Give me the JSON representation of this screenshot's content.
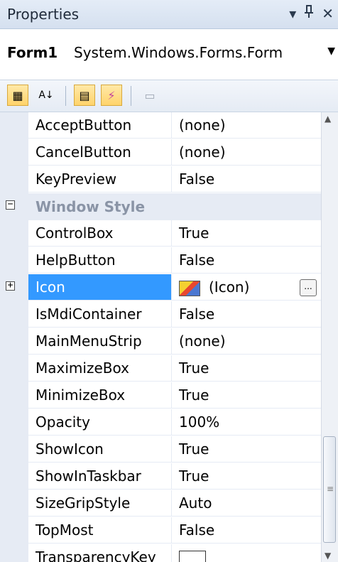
{
  "titlebar": {
    "title": "Properties",
    "dropdown_glyph": "▾",
    "pin_glyph": "𝟰",
    "close_glyph": "✕"
  },
  "object_selector": {
    "name": "Form1",
    "type": "System.Windows.Forms.Form",
    "arrow": "▼"
  },
  "toolbar": {
    "categorized_icon": "▦",
    "alphabetical_icon": "A↓",
    "properties_icon": "▤",
    "events_icon": "⚡",
    "property_pages_icon": "▭"
  },
  "grid": {
    "rows": [
      {
        "name": "AcceptButton",
        "value": "(none)"
      },
      {
        "name": "CancelButton",
        "value": "(none)"
      },
      {
        "name": "KeyPreview",
        "value": "False"
      },
      {
        "category": "Window Style",
        "expander": "−"
      },
      {
        "name": "ControlBox",
        "value": "True"
      },
      {
        "name": "HelpButton",
        "value": "False"
      },
      {
        "name": "Icon",
        "value": "(Icon)",
        "expander": "+",
        "selected": true,
        "ellipsis": "..."
      },
      {
        "name": "IsMdiContainer",
        "value": "False"
      },
      {
        "name": "MainMenuStrip",
        "value": "(none)"
      },
      {
        "name": "MaximizeBox",
        "value": "True"
      },
      {
        "name": "MinimizeBox",
        "value": "True"
      },
      {
        "name": "Opacity",
        "value": "100%"
      },
      {
        "name": "ShowIcon",
        "value": "True"
      },
      {
        "name": "ShowInTaskbar",
        "value": "True"
      },
      {
        "name": "SizeGripStyle",
        "value": "Auto"
      },
      {
        "name": "TopMost",
        "value": "False"
      },
      {
        "name": "TransparencyKey",
        "value": ""
      }
    ]
  },
  "scrollbar": {
    "up_glyph": "▲",
    "down_glyph": "▼",
    "grip_glyph": "≡"
  }
}
